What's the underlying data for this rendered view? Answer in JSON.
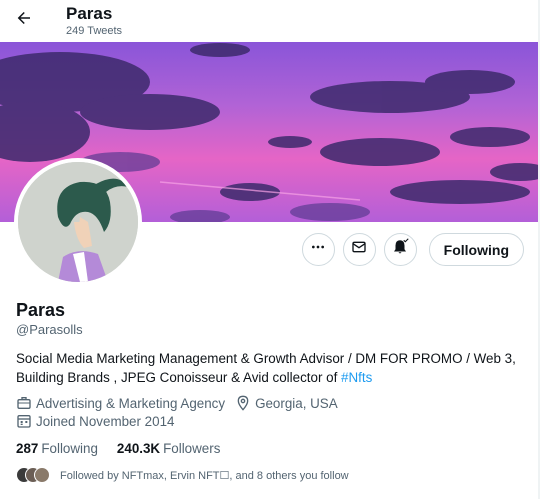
{
  "header": {
    "name": "Paras",
    "tweet_count": "249 Tweets"
  },
  "profile": {
    "display_name": "Paras",
    "handle": "@Parasolls",
    "bio_text": "Social Media Marketing Management & Growth Advisor / DM FOR PROMO / Web 3, Building Brands , JPEG Conoisseur & Avid collector of ",
    "bio_hashtag": "#Nfts",
    "category": "Advertising & Marketing Agency",
    "location": "Georgia, USA",
    "joined": "Joined November 2014",
    "following_count": "287",
    "following_label": "Following",
    "followers_count": "240.3K",
    "followers_label": "Followers",
    "followed_by": "Followed by NFTmax, Ervin NFT☐, and 8 others you follow"
  },
  "actions": {
    "follow_label": "Following"
  },
  "icons": {
    "back": "arrow-left-icon",
    "more": "more-icon",
    "message": "mail-icon",
    "notifications": "bell-icon",
    "category": "briefcase-icon",
    "location": "location-pin-icon",
    "joined": "calendar-icon"
  },
  "colors": {
    "link": "#1d9bf0",
    "secondary_text": "#536471",
    "primary_text": "#0f1419",
    "border": "#cfd9de"
  }
}
